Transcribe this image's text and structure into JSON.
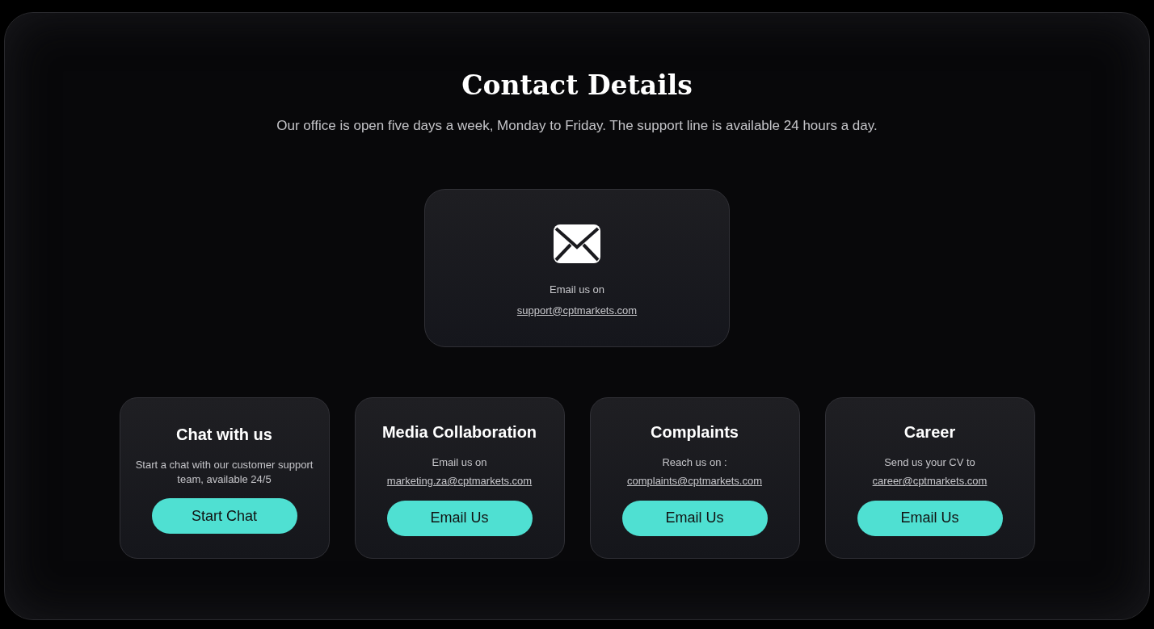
{
  "title": "Contact Details",
  "subtitle": "Our office is open five days a week, Monday to Friday. The support line is available 24 hours a day.",
  "main_card": {
    "text": "Email us on",
    "link": "support@cptmarkets.com"
  },
  "cards": [
    {
      "title": "Chat with us",
      "text": "Start a chat with our customer support team, available 24/5",
      "button": "Start Chat"
    },
    {
      "title": "Media Collaboration",
      "text": "Email us on",
      "link": "marketing.za@cptmarkets.com",
      "button": "Email Us"
    },
    {
      "title": "Complaints",
      "text": "Reach us on :",
      "link": "complaints@cptmarkets.com",
      "button": "Email Us"
    },
    {
      "title": "Career",
      "text": "Send us your CV to",
      "link": "career@cptmarkets.com",
      "button": "Email Us"
    }
  ]
}
